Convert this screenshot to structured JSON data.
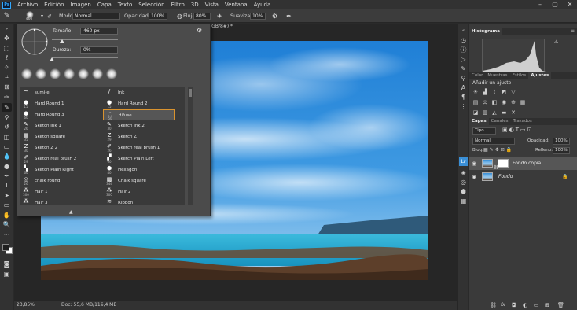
{
  "menu": {
    "app_badge": "Ps",
    "items": [
      "Archivo",
      "Edición",
      "Imagen",
      "Capa",
      "Texto",
      "Selección",
      "Filtro",
      "3D",
      "Vista",
      "Ventana",
      "Ayuda"
    ],
    "window_controls": [
      "–",
      "▢",
      "✕"
    ]
  },
  "options": {
    "brush_size": "460",
    "mode_label": "Modo:",
    "mode_value": "Normal",
    "opacity_label": "Opacidad:",
    "opacity_value": "100%",
    "flow_label": "Flujo:",
    "flow_value": "80%",
    "smoothing_label": "Suavizar:",
    "smoothing_value": "10%"
  },
  "document": {
    "tab_title": "RGB/8#) *",
    "zoom": "23,85%",
    "doc_info": "Doc: 55,6 MB/116,4 MB"
  },
  "brush_picker": {
    "size_label": "Tamaño:",
    "size_value": "460 px",
    "size_fraction": 0.15,
    "hardness_label": "Dureza:",
    "hardness_value": "0%",
    "hardness_fraction": 0.0,
    "brushes": [
      {
        "name": "sumi-e",
        "size": ""
      },
      {
        "name": "Ink",
        "size": ""
      },
      {
        "name": "Hard Round 1",
        "size": "15"
      },
      {
        "name": "Hard Round 2",
        "size": "15"
      },
      {
        "name": "Hard Round 3",
        "size": "60"
      },
      {
        "name": "difuse",
        "size": "50"
      },
      {
        "name": "Sketch Ink 1",
        "size": "26"
      },
      {
        "name": "Sketch Ink 2",
        "size": "30"
      },
      {
        "name": "Sketch square",
        "size": "35"
      },
      {
        "name": "Sketch Z",
        "size": "29"
      },
      {
        "name": "Sketch Z 2",
        "size": "30"
      },
      {
        "name": "Sketch real brush 1",
        "size": "26"
      },
      {
        "name": "Sketch real brush 2",
        "size": "29"
      },
      {
        "name": "Sketch Plain Left",
        "size": "60"
      },
      {
        "name": "Sketch Plain Right",
        "size": "60"
      },
      {
        "name": "Hexagon",
        "size": "40"
      },
      {
        "name": "chalk round",
        "size": "26"
      },
      {
        "name": "Chalk square",
        "size": "344"
      },
      {
        "name": "Hair 1",
        "size": "300"
      },
      {
        "name": "Hair 2",
        "size": "300"
      },
      {
        "name": "Hair 3",
        "size": ""
      },
      {
        "name": "Ribbon",
        "size": ""
      }
    ]
  },
  "histogram_panel": {
    "tab": "Histograma"
  },
  "adjustments_panel": {
    "tabs": [
      "Color",
      "Muestras",
      "Estilos",
      "Ajustes"
    ],
    "title": "Añadir un ajuste"
  },
  "layers_panel": {
    "tabs": [
      "Capas",
      "Canales",
      "Trazados"
    ],
    "filter_value": "Tipo",
    "blend_mode": "Normal",
    "opacity_label": "Opacidad:",
    "opacity_value": "100%",
    "lock_label": "Bloq.:",
    "fill_label": "Relleno:",
    "fill_value": "100%",
    "layers": [
      {
        "name": "Fondo copia",
        "selected": true
      },
      {
        "name": "Fondo",
        "selected": false
      }
    ]
  },
  "colors": {
    "foreground": "#1f1f1f",
    "background": "#ffffff",
    "accent_selection": "#d9932f",
    "ps_blue": "#31a8ff"
  },
  "icons": [
    "ps-logo-icon",
    "brush-icon",
    "brush-settings-icon",
    "airbrush-icon",
    "pressure-size-icon",
    "symmetry-icon",
    "eye-icon",
    "lock-icon",
    "fx-icon",
    "trash-icon",
    "new-layer-icon",
    "mask-icon",
    "folder-icon"
  ]
}
